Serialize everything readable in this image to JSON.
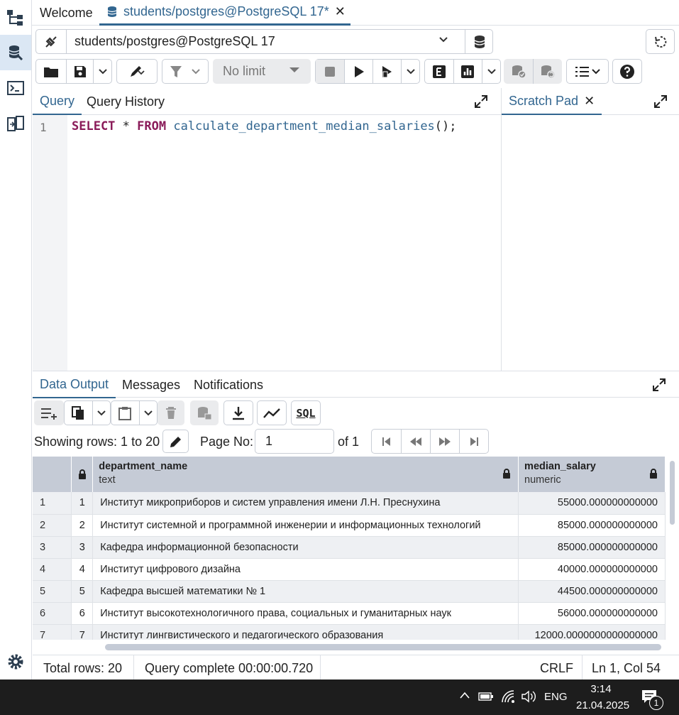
{
  "tabs": [
    {
      "label": "Welcome"
    },
    {
      "label": "students/postgres@PostgreSQL 17*"
    }
  ],
  "connection": {
    "label": "students/postgres@PostgreSQL 17"
  },
  "toolbar": {
    "limit_label": "No limit",
    "sql_label": "SQL"
  },
  "editor": {
    "tabs": [
      "Query",
      "Query History"
    ],
    "line_number": "1",
    "code": {
      "kw1": "SELECT",
      "star": " * ",
      "kw2": "FROM",
      "fn": " calculate_department_median_salaries",
      "rest": "();"
    }
  },
  "scratch": {
    "title": "Scratch Pad"
  },
  "results": {
    "tabs": [
      "Data Output",
      "Messages",
      "Notifications"
    ],
    "showing": "Showing rows: 1 to 20",
    "page_label": "Page No:",
    "page_value": "1",
    "of_label": "of 1",
    "columns": [
      {
        "name": "department_name",
        "type": "text"
      },
      {
        "name": "median_salary",
        "type": "numeric"
      }
    ],
    "rows": [
      {
        "n": "1",
        "idx": "1",
        "dept": "Институт микроприборов и систем управления имени Л.Н. Преснухина",
        "salary": "55000.000000000000"
      },
      {
        "n": "2",
        "idx": "2",
        "dept": "Институт системной и программной инженерии и информационных технологий",
        "salary": "85000.000000000000"
      },
      {
        "n": "3",
        "idx": "3",
        "dept": "Кафедра информационной безопасности",
        "salary": "85000.000000000000"
      },
      {
        "n": "4",
        "idx": "4",
        "dept": "Институт цифрового дизайна",
        "salary": "40000.000000000000"
      },
      {
        "n": "5",
        "idx": "5",
        "dept": "Кафедра высшей математики № 1",
        "salary": "44500.000000000000"
      },
      {
        "n": "6",
        "idx": "6",
        "dept": "Институт высокотехнологичного права, социальных и гуманитарных наук",
        "salary": "56000.000000000000"
      },
      {
        "n": "7",
        "idx": "7",
        "dept": "Институт лингвистического и педагогического образования",
        "salary": "12000.0000000000000000"
      }
    ]
  },
  "status": {
    "total": "Total rows: 20",
    "query": "Query complete 00:00:00.720",
    "eol": "CRLF",
    "pos": "Ln 1, Col 54"
  },
  "taskbar": {
    "lang": "ENG",
    "time": "3:14",
    "date": "21.04.2025",
    "notif": "1"
  }
}
